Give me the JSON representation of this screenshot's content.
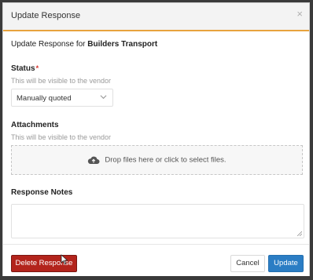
{
  "modal": {
    "title": "Update Response",
    "close_glyph": "×",
    "subtitle_prefix": "Update Response for",
    "vendor_name": "Builders Transport"
  },
  "status": {
    "label": "Status",
    "required_mark": "*",
    "help": "This will be visible to the vendor",
    "selected": "Manually quoted"
  },
  "attachments": {
    "label": "Attachments",
    "help": "This will be visible to the vendor",
    "dropzone_text": "Drop files here or click to select files.",
    "icon": "cloud-upload-icon"
  },
  "notes": {
    "label": "Response Notes",
    "value": ""
  },
  "footer": {
    "delete_label": "Delete Response",
    "cancel_label": "Cancel",
    "update_label": "Update"
  },
  "colors": {
    "accent_border": "#e8a33d",
    "delete_bg": "#b3241c",
    "update_bg": "#2b7dc4",
    "required": "#d9332c"
  }
}
